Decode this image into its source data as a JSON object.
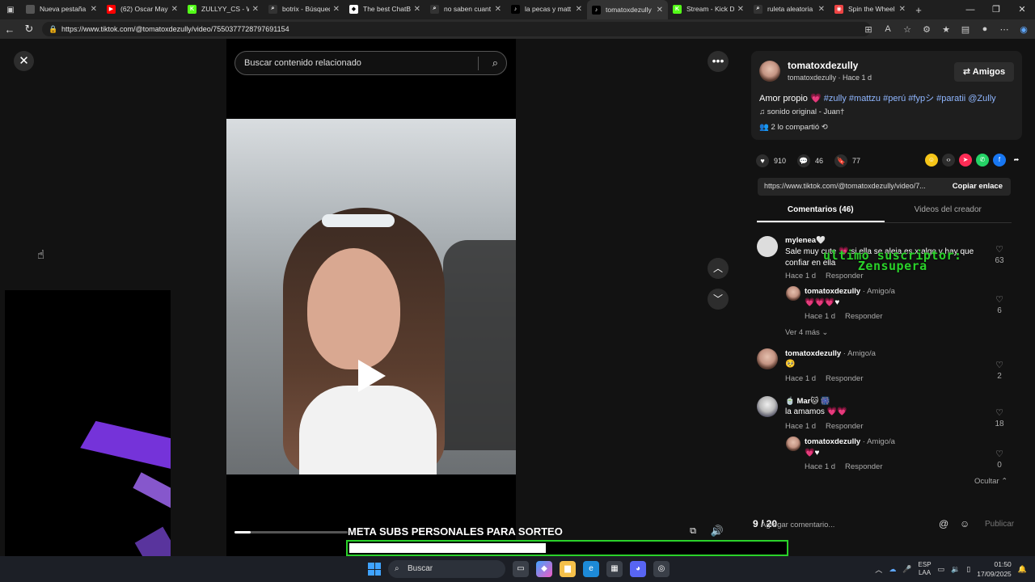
{
  "browser": {
    "tabs": [
      {
        "label": "Nueva pestaña",
        "fav_color": "#555",
        "fav": ""
      },
      {
        "label": "(62) Oscar Mayd",
        "fav_color": "#ff0000",
        "fav": "▶"
      },
      {
        "label": "ZULLYY_CS - Wa",
        "fav_color": "#53fc18",
        "fav": "K"
      },
      {
        "label": "botrix - Búsqued",
        "fav_color": "#333",
        "fav": "⌕"
      },
      {
        "label": "The best ChatBo",
        "fav_color": "#fff",
        "fav": "◆"
      },
      {
        "label": "no saben cuant",
        "fav_color": "#333",
        "fav": "⌕"
      },
      {
        "label": "la pecas y matt",
        "fav_color": "#000",
        "fav": "♪"
      },
      {
        "label": "tomatoxdezully",
        "fav_color": "#000",
        "fav": "♪"
      },
      {
        "label": "Stream - Kick Da",
        "fav_color": "#53fc18",
        "fav": "K"
      },
      {
        "label": "ruleta aleatoria",
        "fav_color": "#333",
        "fav": "⌕"
      },
      {
        "label": "Spin the Wheel",
        "fav_color": "#e44",
        "fav": "◉"
      }
    ],
    "url": "https://www.tiktok.com/@tomatoxdezully/video/7550377728797691154"
  },
  "video": {
    "search_placeholder": "Buscar contenido relacionado",
    "progress": 0.14
  },
  "creator": {
    "username": "tomatoxdezully",
    "subline": "tomatoxdezully · Hace 1 d",
    "friends_button": "⇄ Amigos",
    "desc_text": "Amor propio 💗 ",
    "desc_tags": "#zully #mattzu #perú #fypシ #paratii @Zully",
    "music": "♫  sonido original - Juan†",
    "shared": "2 lo compartió"
  },
  "actions": {
    "likes": "910",
    "comments": "46",
    "saves": "77"
  },
  "link": {
    "text": "https://www.tiktok.com/@tomatoxdezully/video/7...",
    "copy_label": "Copiar enlace"
  },
  "tabs": {
    "comments": "Comentarios (46)",
    "creator_videos": "Videos del creador"
  },
  "comments": [
    {
      "name": "mylenea🤍",
      "text": "Sale muy cute 💗 si ella se aleja es x algo y hay que confiar en ella",
      "meta": "Hace 1 d",
      "reply": "Responder",
      "likes": "63"
    },
    {
      "name": "tomatoxdezully",
      "tag": " · Amigo/a",
      "text": "💗💗💗♥",
      "meta": "Hace 1 d",
      "reply": "Responder",
      "likes": "6"
    },
    {
      "name": "tomatoxdezully",
      "tag": " · Amigo/a",
      "text": "🥺",
      "meta": "Hace 1 d",
      "reply": "Responder",
      "likes": "2"
    },
    {
      "name": "🍵 Mar🐱 🎆",
      "text": "la amamos 💗💗",
      "meta": "Hace 1 d",
      "reply": "Responder",
      "likes": "18"
    },
    {
      "name": "tomatoxdezully",
      "tag": " · Amigo/a",
      "text": "💗♥",
      "meta": "Hace 1 d",
      "reply": "Responder",
      "likes": "0"
    }
  ],
  "see_more": "Ver 4 más ⌄",
  "hide": "Ocultar ⌃",
  "overlay": {
    "sub_alert_line1": "ultimo suscriptor:",
    "sub_alert_line2": "Zensupera",
    "goal_title": "META SUBS PERSONALES PARA SORTEO",
    "goal_count": "9 / 20",
    "goal_progress": 0.45
  },
  "comment_input": {
    "placeholder": "Agregar comentario...",
    "publish": "Publicar"
  },
  "taskbar": {
    "search": "Buscar",
    "lang1": "ESP",
    "lang2": "LAA",
    "time": "01:50",
    "date": "17/09/2025"
  }
}
